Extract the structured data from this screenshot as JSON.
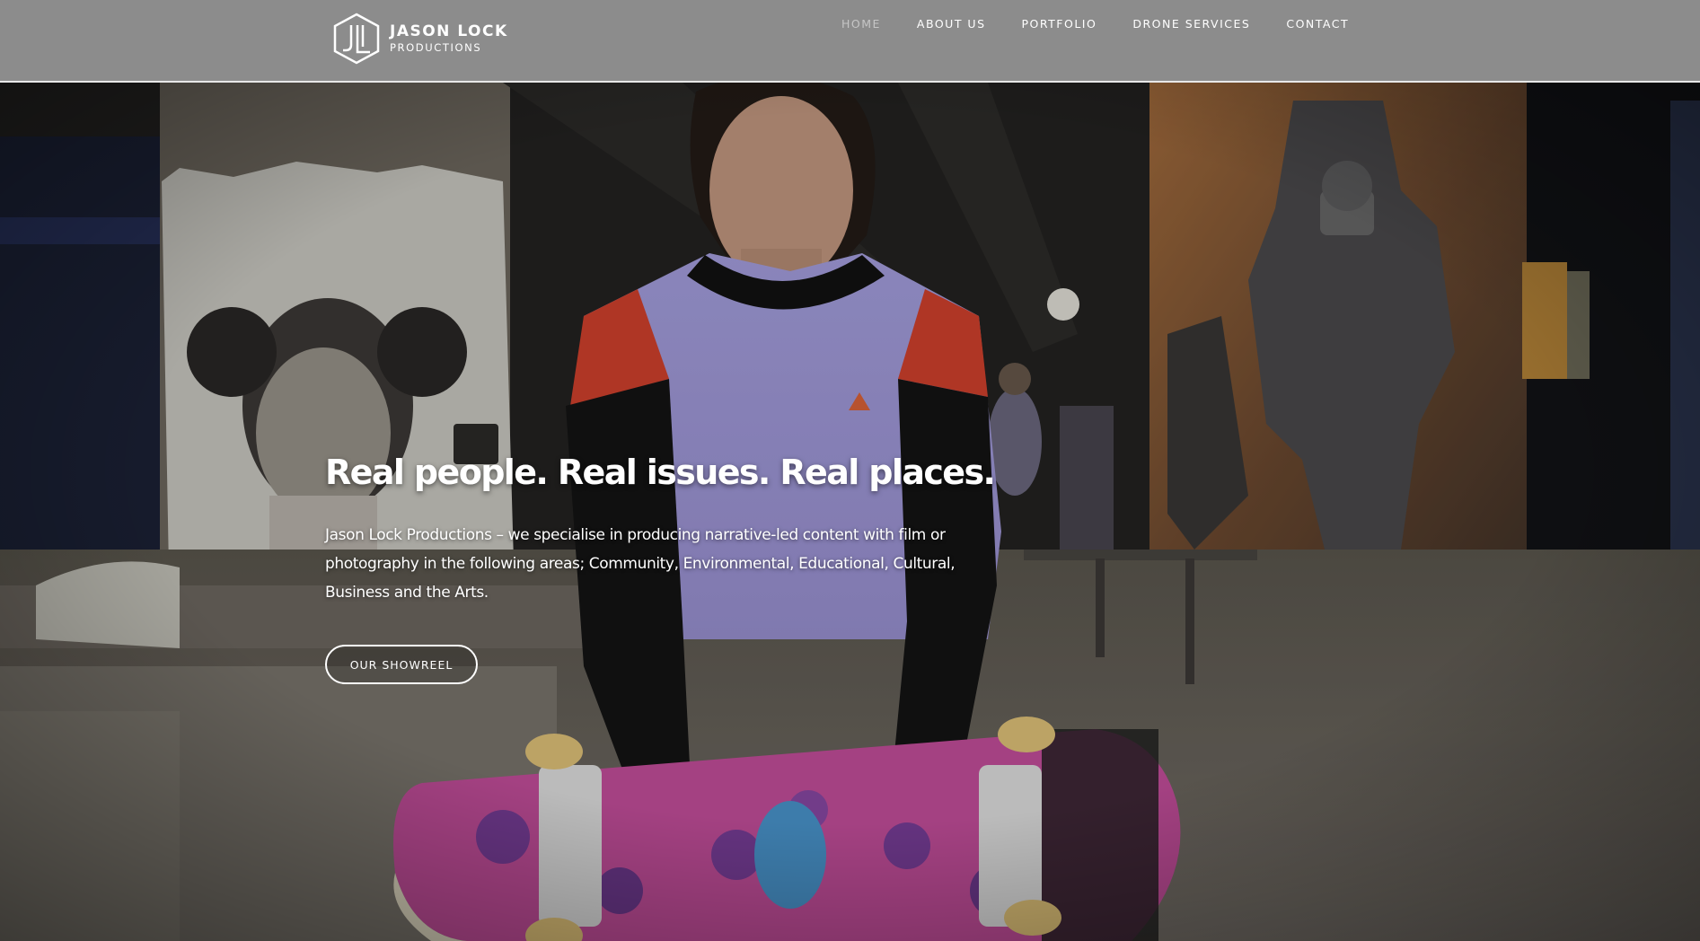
{
  "brand": {
    "name": "JASON LOCK",
    "subtitle": "PRODUCTIONS",
    "logo_icon": "hexagon-jl-monogram-icon"
  },
  "nav": {
    "items": [
      {
        "label": "HOME",
        "active": true
      },
      {
        "label": "ABOUT US",
        "active": false
      },
      {
        "label": "PORTFOLIO",
        "active": false
      },
      {
        "label": "DRONE SERVICES",
        "active": false
      },
      {
        "label": "CONTACT",
        "active": false
      }
    ]
  },
  "hero": {
    "title": "Real people. Real issues. Real places.",
    "description": "Jason Lock Productions – we specialise in producing narrative-led content with film or photography in the following areas; Community, Environmental, Educational, Cultural, Business and the Arts.",
    "cta_label": "OUR SHOWREEL",
    "background": "photo-of-young-woman-holding-skateboard-in-skatepark"
  },
  "colors": {
    "header_bg": "#8c8c8c",
    "header_border": "#e8e8e8",
    "nav_text": "#ffffff",
    "nav_active": "#c6c6c6",
    "hero_text": "#ffffff"
  }
}
